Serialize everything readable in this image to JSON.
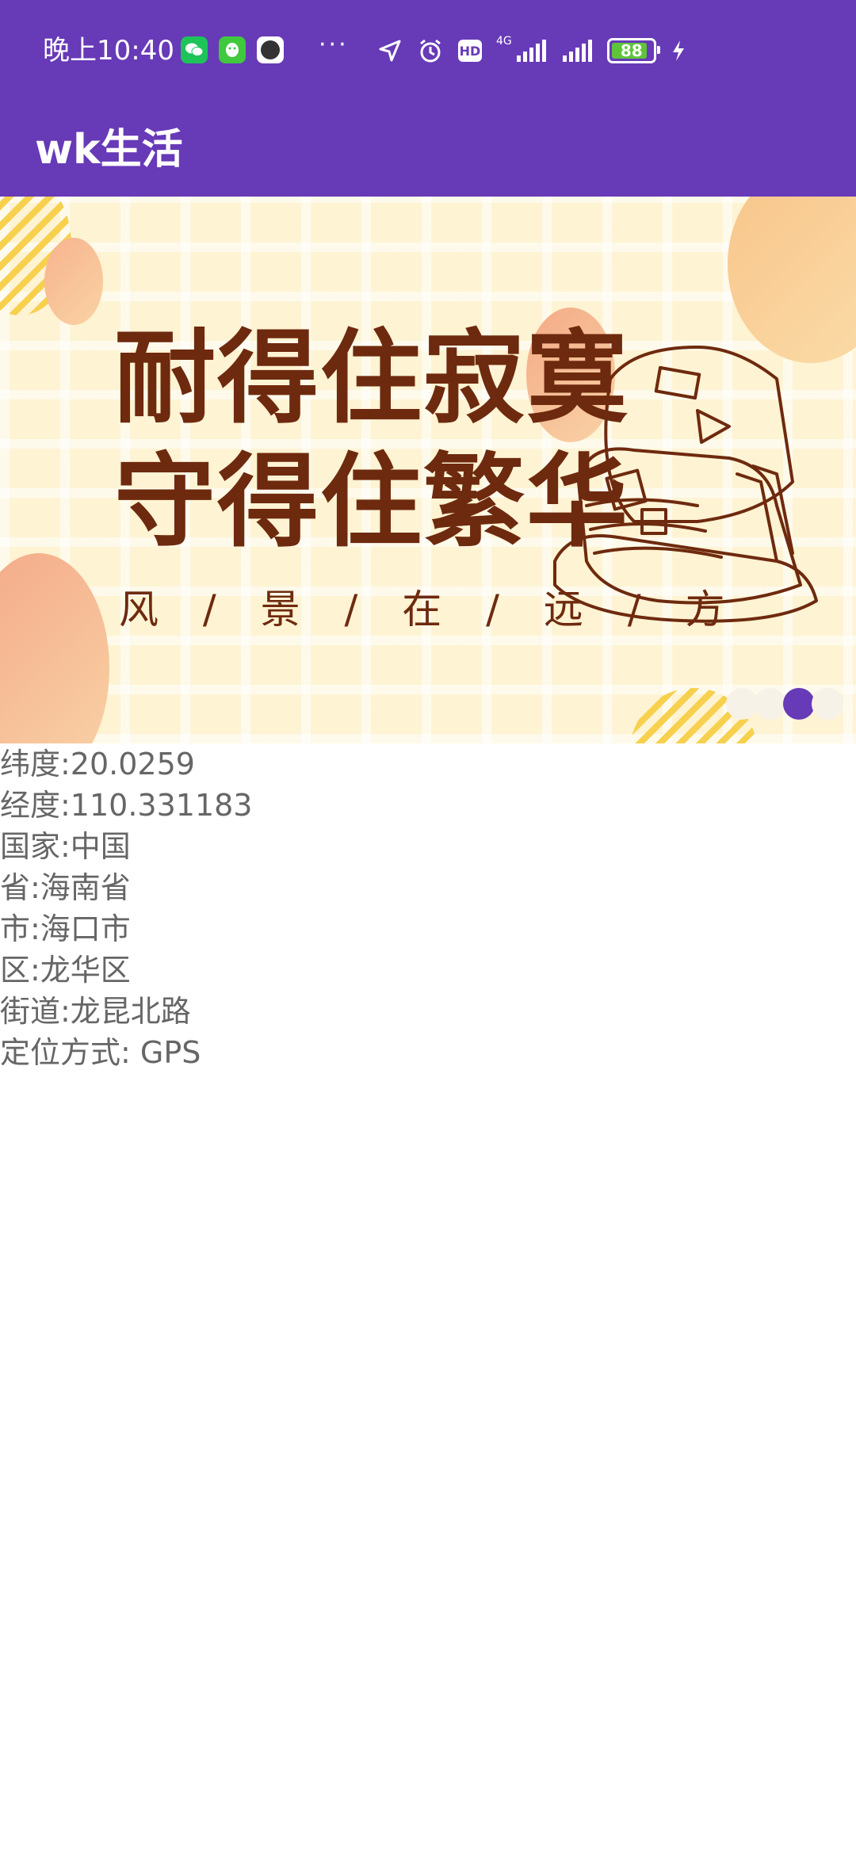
{
  "status_bar": {
    "time": "晚上10:40",
    "network": "4G",
    "battery": "88",
    "notifications": [
      "wechat-icon",
      "qq-icon",
      "clock-app-icon"
    ],
    "more": "···"
  },
  "toolbar": {
    "title": "wk生活",
    "color": "#673AB7"
  },
  "banner": {
    "line1": "耐得住寂寞",
    "line2": "守得住繁华",
    "subtitle": "风 / 景 / 在 / 远 / 方",
    "pager": {
      "count": 4,
      "active_index": 2
    }
  },
  "location": {
    "latitude": "纬度:20.0259",
    "longitude": "经度:110.331183",
    "country": "国家:中国",
    "province": "省:海南省",
    "city": "市:海口市",
    "district": "区:龙华区",
    "street": "街道:龙昆北路",
    "method": "定位方式: GPS"
  }
}
